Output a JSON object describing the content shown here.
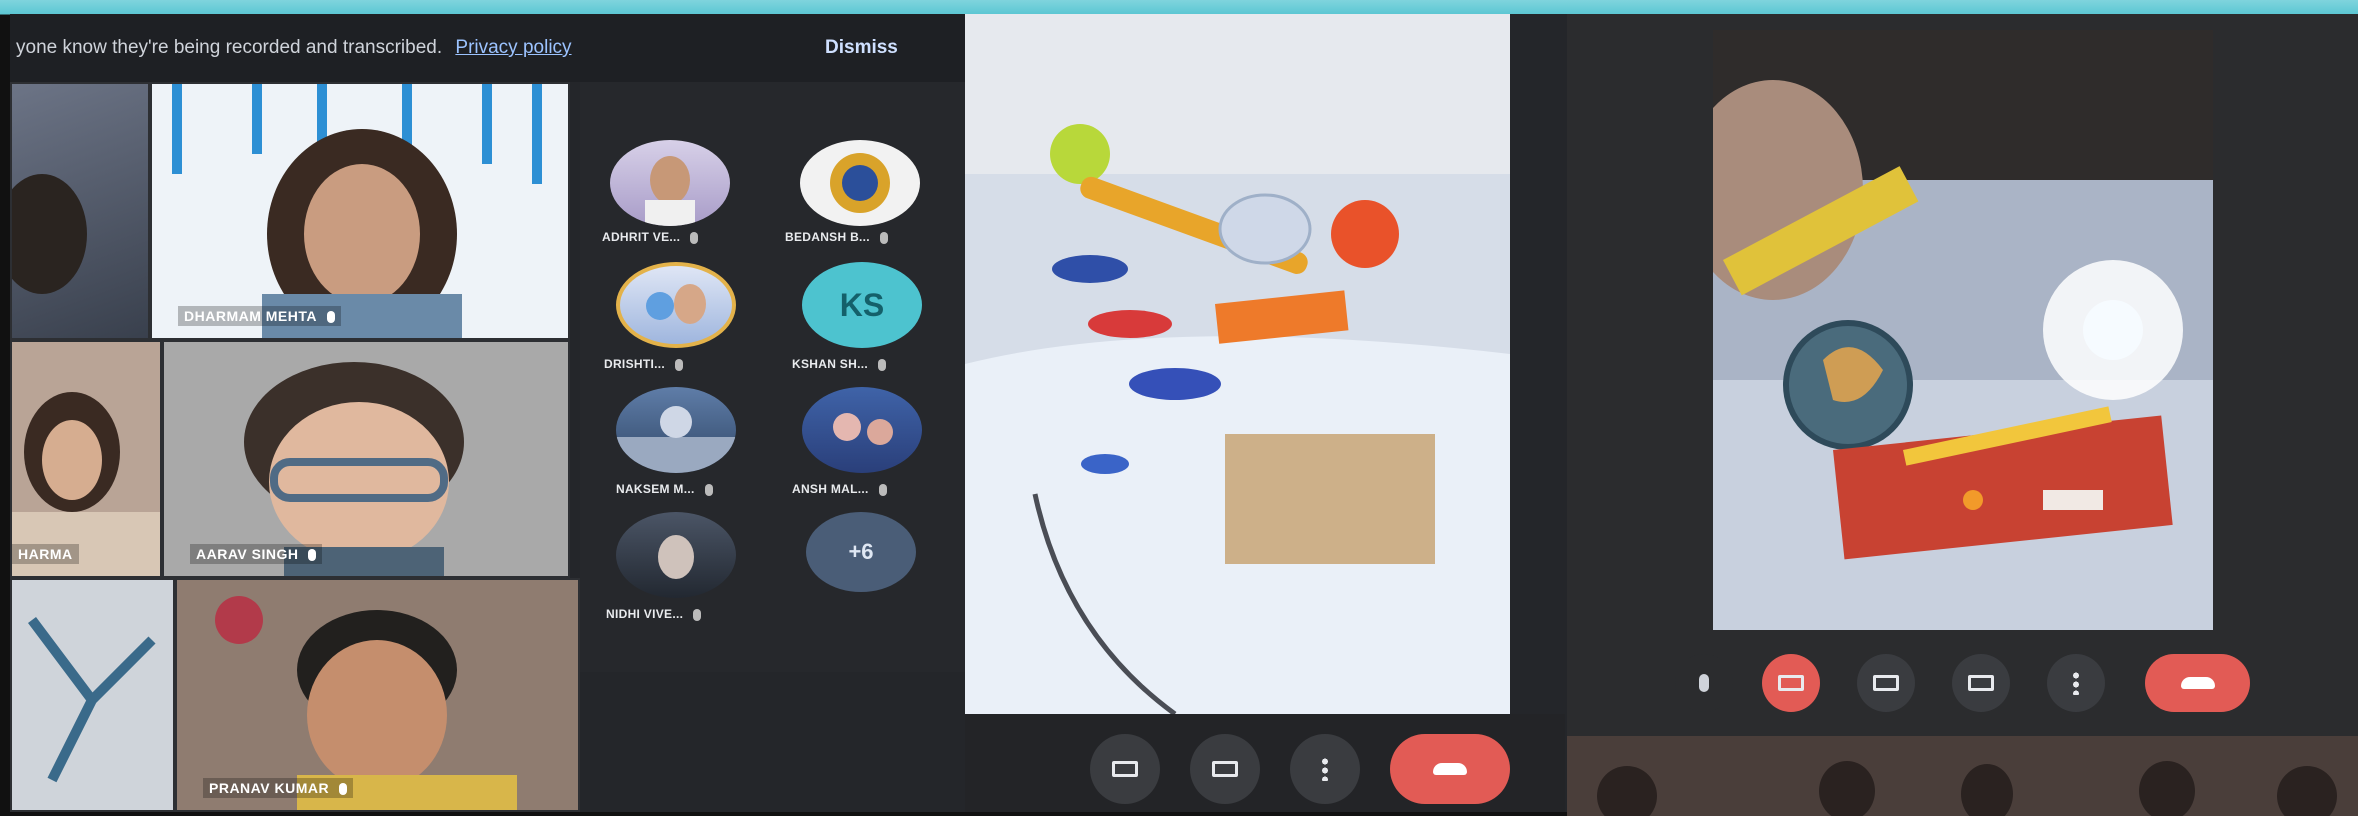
{
  "banner": {
    "text": "yone know they're being recorded and transcribed.",
    "link": "Privacy policy",
    "dismiss": "Dismiss"
  },
  "tiles": [
    {
      "name": "",
      "color": "#5a6070"
    },
    {
      "name": "DHARMAM MEHTA",
      "color": "#e8eef6"
    },
    {
      "name": "HARMA",
      "color": "#b9a496"
    },
    {
      "name": "AARAV SINGH",
      "color": "#a9a9a9"
    },
    {
      "name": "",
      "color": "#7c8a96"
    },
    {
      "name": "PRANAV KUMAR",
      "color": "#8f7c70"
    }
  ],
  "participants": [
    {
      "name": "ADHRIT VE...",
      "type": "photo"
    },
    {
      "name": "BEDANSH B...",
      "type": "logo"
    },
    {
      "name": "DRISHTI...",
      "type": "photo"
    },
    {
      "name": "KSHAN SH...",
      "type": "initials",
      "initials": "KS"
    },
    {
      "name": "NAKSEM M...",
      "type": "photo"
    },
    {
      "name": "ANSH MAL...",
      "type": "photo"
    },
    {
      "name": "NIDHI VIVE...",
      "type": "photo"
    },
    {
      "name": "",
      "type": "more",
      "label": "+6"
    }
  ],
  "controls_left": [
    "captions-icon",
    "present-icon",
    "more-options-icon",
    "end-call-icon"
  ],
  "controls_right": [
    "mic-icon",
    "camera-off-icon",
    "captions-icon",
    "present-icon",
    "more-options-icon",
    "end-call-icon"
  ],
  "colors": {
    "accent_red": "#e25b55",
    "initials_bg": "#4dc3cf",
    "frame": "#1fb3c8"
  }
}
